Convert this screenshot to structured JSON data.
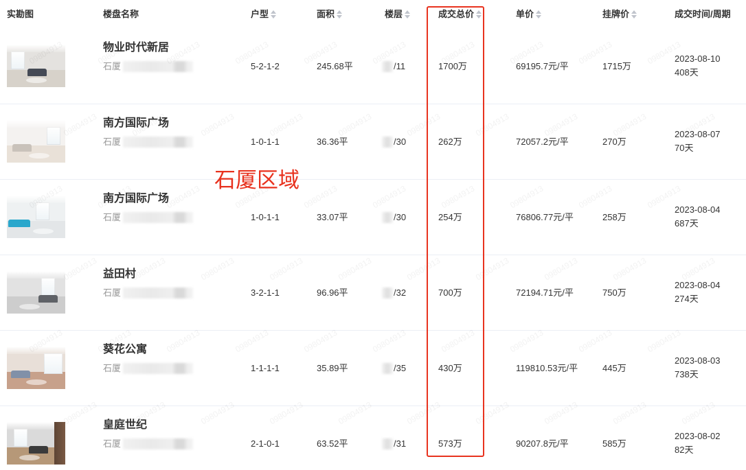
{
  "header": {
    "photo": "实勘图",
    "name": "楼盘名称",
    "layout": "户型",
    "area": "面积",
    "floor": "楼层",
    "total_price": "成交总价",
    "unit_price": "单价",
    "list_price": "挂牌价",
    "deal_time": "成交时间/周期"
  },
  "annotation": {
    "text": "石厦区域"
  },
  "watermark": "09804913",
  "colors": {
    "text": "#333333",
    "muted": "#999999",
    "annotation": "#e8321e",
    "divider": "#ebeef5",
    "sort_icon": "#c0c4cc"
  },
  "rows": [
    {
      "name": "物业时代新居",
      "district": "石厦",
      "layout": "5-2-1-2",
      "area": "245.68平",
      "floor": "/11",
      "total_price": "1700万",
      "unit_price": "69195.7元/平",
      "list_price": "1715万",
      "deal_date": "2023-08-10",
      "cycle": "408天",
      "thumb": {
        "wall": "#e4e2df",
        "floor": "#d7d2ca",
        "accent": "#454a55"
      }
    },
    {
      "name": "南方国际广场",
      "district": "石厦",
      "layout": "1-0-1-1",
      "area": "36.36平",
      "floor": "/30",
      "total_price": "262万",
      "unit_price": "72057.2元/平",
      "list_price": "270万",
      "deal_date": "2023-08-07",
      "cycle": "70天",
      "thumb": {
        "wall": "#f4f2f0",
        "floor": "#e9e1d8",
        "accent": "#c9c2ba"
      }
    },
    {
      "name": "南方国际广场",
      "district": "石厦",
      "layout": "1-0-1-1",
      "area": "33.07平",
      "floor": "/30",
      "total_price": "254万",
      "unit_price": "76806.77元/平",
      "list_price": "258万",
      "deal_date": "2023-08-04",
      "cycle": "687天",
      "thumb": {
        "wall": "#eef1f2",
        "floor": "#e3e6e8",
        "accent": "#2aa7cc"
      }
    },
    {
      "name": "益田村",
      "district": "石厦",
      "layout": "3-2-1-1",
      "area": "96.96平",
      "floor": "/32",
      "total_price": "700万",
      "unit_price": "72194.71元/平",
      "list_price": "750万",
      "deal_date": "2023-08-04",
      "cycle": "274天",
      "thumb": {
        "wall": "#e2e2e2",
        "floor": "#cdcdcd",
        "accent": "#5f6267"
      }
    },
    {
      "name": "葵花公寓",
      "district": "石厦",
      "layout": "1-1-1-1",
      "area": "35.89平",
      "floor": "/35",
      "total_price": "430万",
      "unit_price": "119810.53元/平",
      "list_price": "445万",
      "deal_date": "2023-08-03",
      "cycle": "738天",
      "thumb": {
        "wall": "#e8dfd8",
        "floor": "#c7a18b",
        "accent": "#8190a8"
      }
    },
    {
      "name": "皇庭世纪",
      "district": "石厦",
      "layout": "2-1-0-1",
      "area": "63.52平",
      "floor": "/31",
      "total_price": "573万",
      "unit_price": "90207.8元/平",
      "list_price": "585万",
      "deal_date": "2023-08-02",
      "cycle": "82天",
      "thumb": {
        "wall": "#dadada",
        "floor": "#b69878",
        "accent": "#3b3b3b"
      }
    }
  ]
}
